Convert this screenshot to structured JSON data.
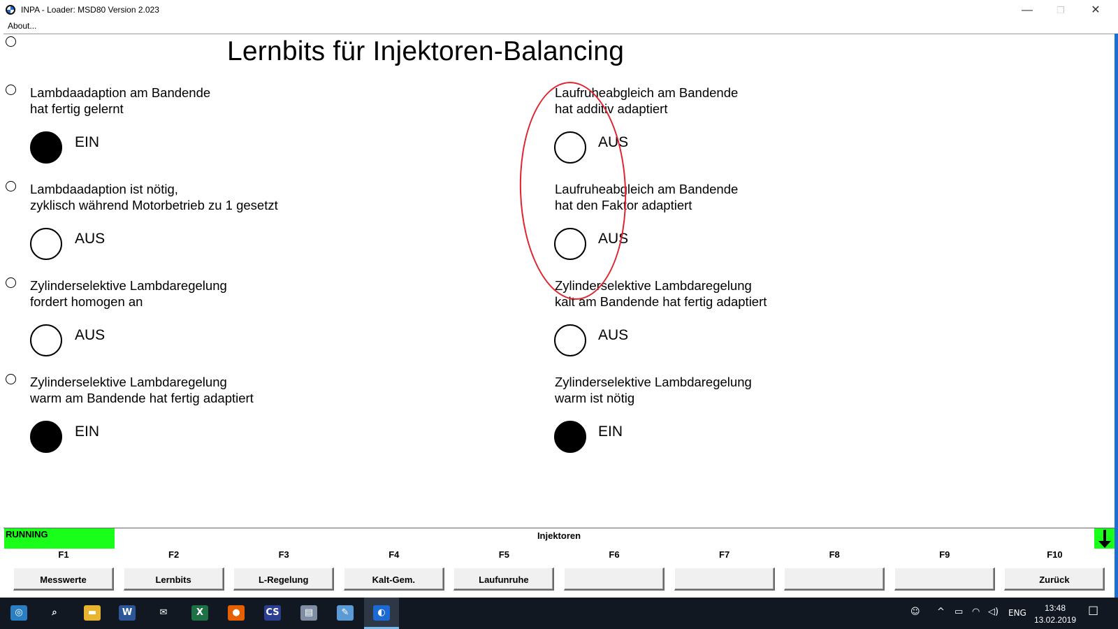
{
  "window": {
    "title": "INPA - Loader:  MSD80 Version 2.023",
    "menu_about": "About...",
    "controls": {
      "minimize": "—",
      "maximize": "❐",
      "close": "✕"
    }
  },
  "screen": {
    "title": "Lernbits für Injektoren-Balancing",
    "items_left": [
      {
        "line1": "Lambdaadaption am Bandende",
        "line2": "hat fertig gelernt",
        "state": "EIN",
        "on": true
      },
      {
        "line1": "Lambdaadaption ist nötig,",
        "line2": "zyklisch während Motorbetrieb zu 1 gesetzt",
        "state": "AUS",
        "on": false
      },
      {
        "line1": "Zylinderselektive Lambdaregelung",
        "line2": "fordert homogen an",
        "state": "AUS",
        "on": false
      },
      {
        "line1": "Zylinderselektive Lambdaregelung",
        "line2": "warm am Bandende hat fertig adaptiert",
        "state": "EIN",
        "on": true
      }
    ],
    "items_right": [
      {
        "line1": "Laufruheabgleich am Bandende",
        "line2": "hat additiv adaptiert",
        "state": "AUS",
        "on": false
      },
      {
        "line1": "Laufruheabgleich am Bandende",
        "line2": "hat den Faktor adaptiert",
        "state": "AUS",
        "on": false
      },
      {
        "line1": "Zylinderselektive Lambdaregelung",
        "line2": "kalt am Bandende hat fertig adaptiert",
        "state": "AUS",
        "on": false
      },
      {
        "line1": "Zylinderselektive Lambdaregelung",
        "line2": "warm ist nötig",
        "state": "EIN",
        "on": true
      }
    ]
  },
  "statusbar": {
    "status": "RUNNING",
    "section": "Injektoren",
    "fkeys": [
      "F1",
      "F2",
      "F3",
      "F4",
      "F5",
      "F6",
      "F7",
      "F8",
      "F9",
      "F10"
    ],
    "buttons": [
      "Messwerte",
      "Lernbits",
      "L-Regelung",
      "Kalt-Gem.",
      "Laufunruhe",
      "",
      "",
      "",
      "",
      "Zurück"
    ]
  },
  "colors": {
    "status_green": "#19ff19",
    "annotation_red": "#e0232e",
    "taskbar": "#111821"
  },
  "taskbar": {
    "apps": [
      {
        "name": "start",
        "glyph": "◎",
        "color": "#2a7fc2"
      },
      {
        "name": "search",
        "glyph": "⌕",
        "color": "transparent"
      },
      {
        "name": "file-explorer",
        "glyph": "▬",
        "color": "#e8b530"
      },
      {
        "name": "word",
        "glyph": "W",
        "color": "#2b5797"
      },
      {
        "name": "mail",
        "glyph": "✉",
        "color": "transparent"
      },
      {
        "name": "excel",
        "glyph": "X",
        "color": "#1e7145"
      },
      {
        "name": "firefox",
        "glyph": "●",
        "color": "#e66000"
      },
      {
        "name": "cs-app",
        "glyph": "CS",
        "color": "#2c3e8f"
      },
      {
        "name": "tool-app",
        "glyph": "▤",
        "color": "#7f8ea3"
      },
      {
        "name": "paint-app",
        "glyph": "✎",
        "color": "#5a9bd5"
      },
      {
        "name": "bmw-inpa",
        "glyph": "◐",
        "color": "#1c69d4"
      }
    ],
    "tray": {
      "people": "☺",
      "chevron": "^",
      "battery": "▭",
      "network": "◠",
      "volume": "◁)",
      "lang": "ENG",
      "notifications": "☐"
    },
    "time": "13:48",
    "date": "13.02.2019"
  }
}
